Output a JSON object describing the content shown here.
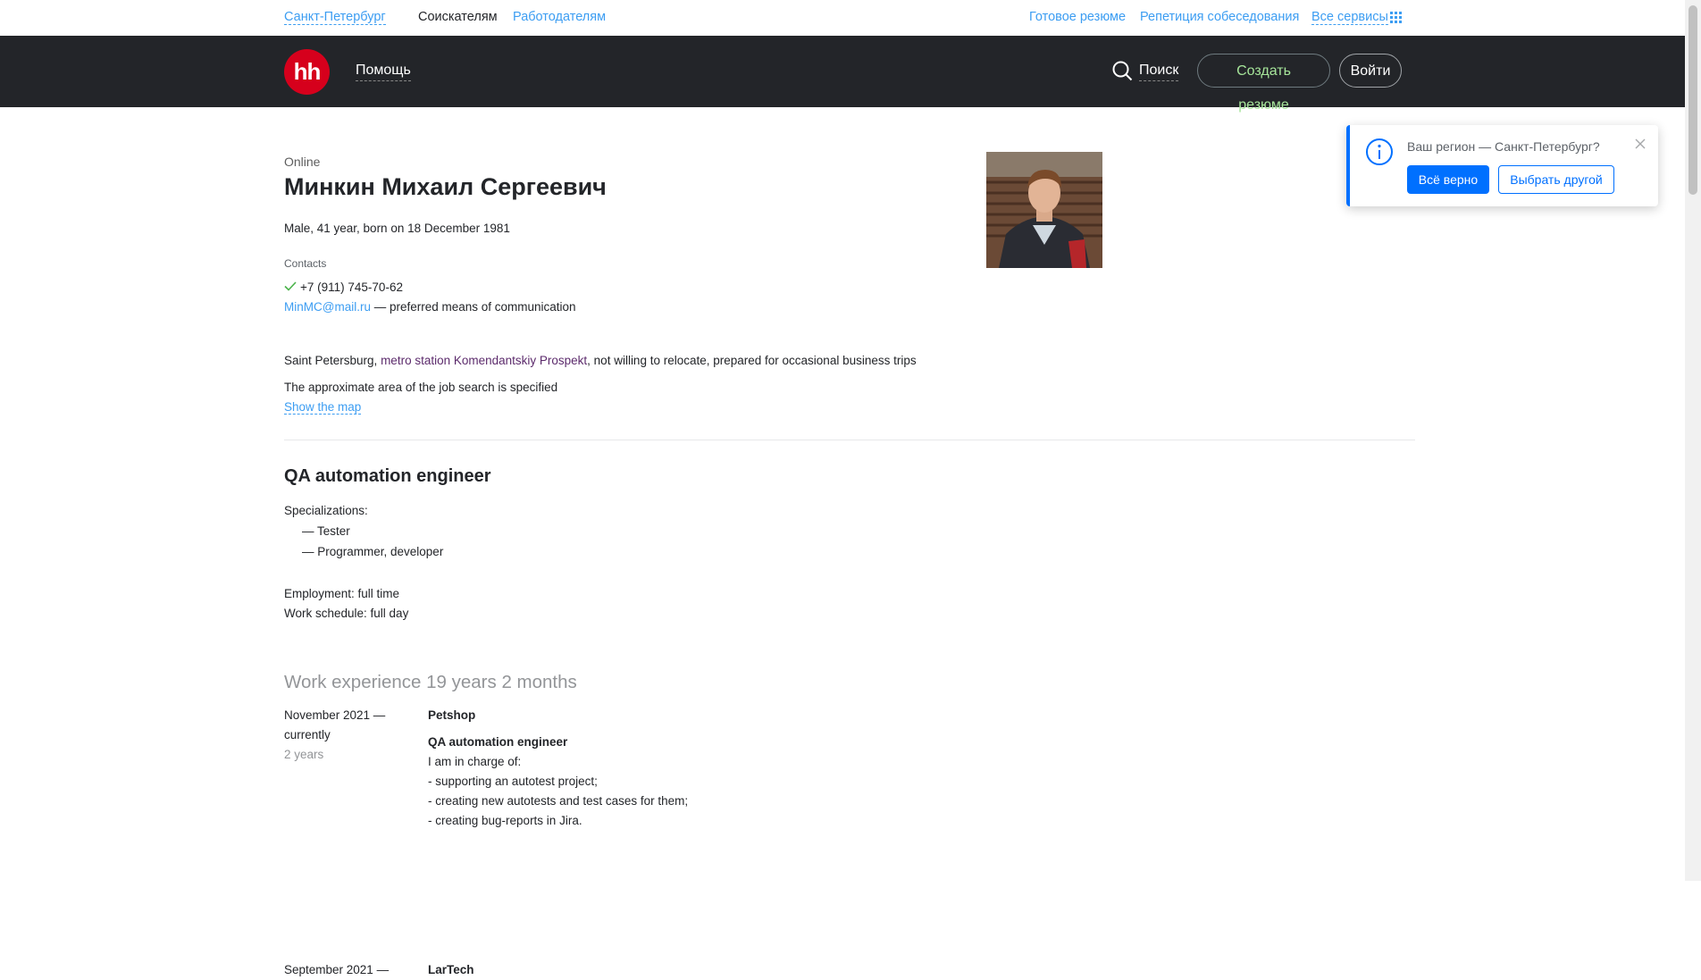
{
  "topbar": {
    "city": "Санкт-Петербург",
    "seekers": "Соискателям",
    "employers": "Работодателям",
    "ready_resume": "Готовое резюме",
    "interview_rehearsal": "Репетиция собеседования",
    "all_services": "Все сервисы"
  },
  "header": {
    "logo": "hh",
    "help": "Помощь",
    "search": "Поиск",
    "create_resume": "Создать резюме",
    "login": "Войти"
  },
  "profile": {
    "status": "Online",
    "name": "Минкин Михаил Сергеевич",
    "meta": "Male, 41 year, born on 18 December 1981",
    "contacts_heading": "Contacts",
    "phone": "+7 (911) 745-70-62",
    "email": "MinMC@mail.ru",
    "email_note": " — preferred means of communication",
    "city": "Saint Petersburg, ",
    "metro": "metro station Komendantskiy Prospekt",
    "relocation": ", not willing to relocate, prepared for occasional business trips",
    "approx_area": "The approximate area of the job search is specified",
    "show_map": "Show the map"
  },
  "position": {
    "title": "QA automation engineer",
    "specializations_label": "Specializations:",
    "specializations": [
      "— Tester",
      "— Programmer, developer"
    ],
    "employment": "Employment: full time",
    "schedule": "Work schedule: full day"
  },
  "experience": {
    "heading": "Work experience 19 years 2 months",
    "jobs": [
      {
        "date_start": "November 2021 —",
        "date_end": "currently",
        "duration": "2 years",
        "company": "Petshop",
        "role": "QA automation engineer",
        "lines": [
          "I am in charge of:",
          "- supporting an autotest project;",
          "- creating new autotests and test cases for them;",
          "- creating bug-reports in Jira."
        ]
      },
      {
        "date_start": "September 2021 —",
        "company": "LarTech"
      }
    ]
  },
  "region_popup": {
    "question": "Ваш регион — Санкт-Петербург?",
    "confirm": "Всё верно",
    "choose_other": "Выбрать другой"
  },
  "colors": {
    "header_bg": "#232529",
    "logo_red": "#d6001c",
    "accent_blue": "#0070ff",
    "link_blue": "#3c9df2",
    "create_green": "#a6e59a"
  }
}
